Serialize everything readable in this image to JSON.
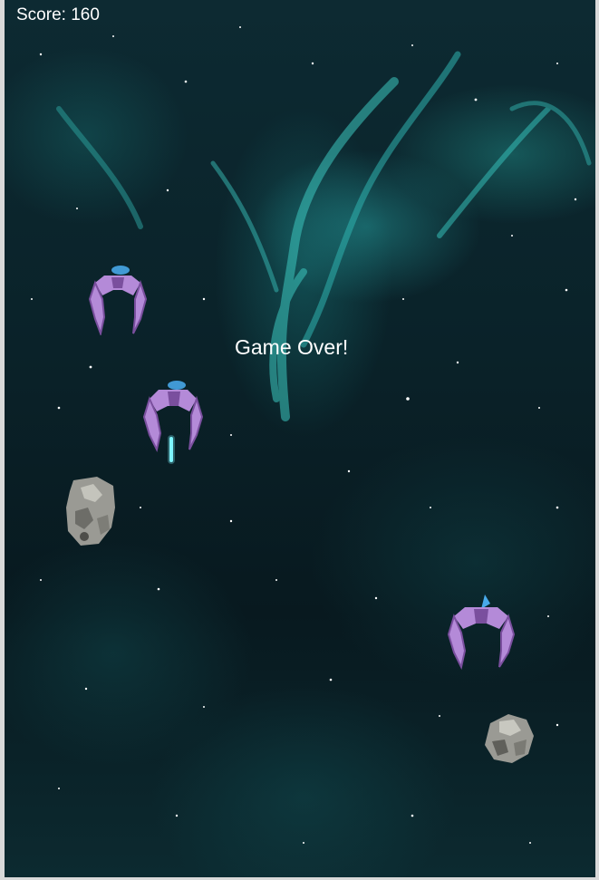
{
  "hud": {
    "score_label": "Score:",
    "score_value": "160",
    "game_over_text": "Game Over!"
  },
  "entities": {
    "enemy_ships": 3,
    "asteroids": 2,
    "projectiles": 1
  },
  "colors": {
    "ship_body": "#b48ad8",
    "ship_shadow": "#7a4f9e",
    "engine_glow": "#4fb8ff",
    "laser": "#7ff5ff",
    "asteroid": "#9a9a94",
    "nebula": "#2fb3b0"
  }
}
